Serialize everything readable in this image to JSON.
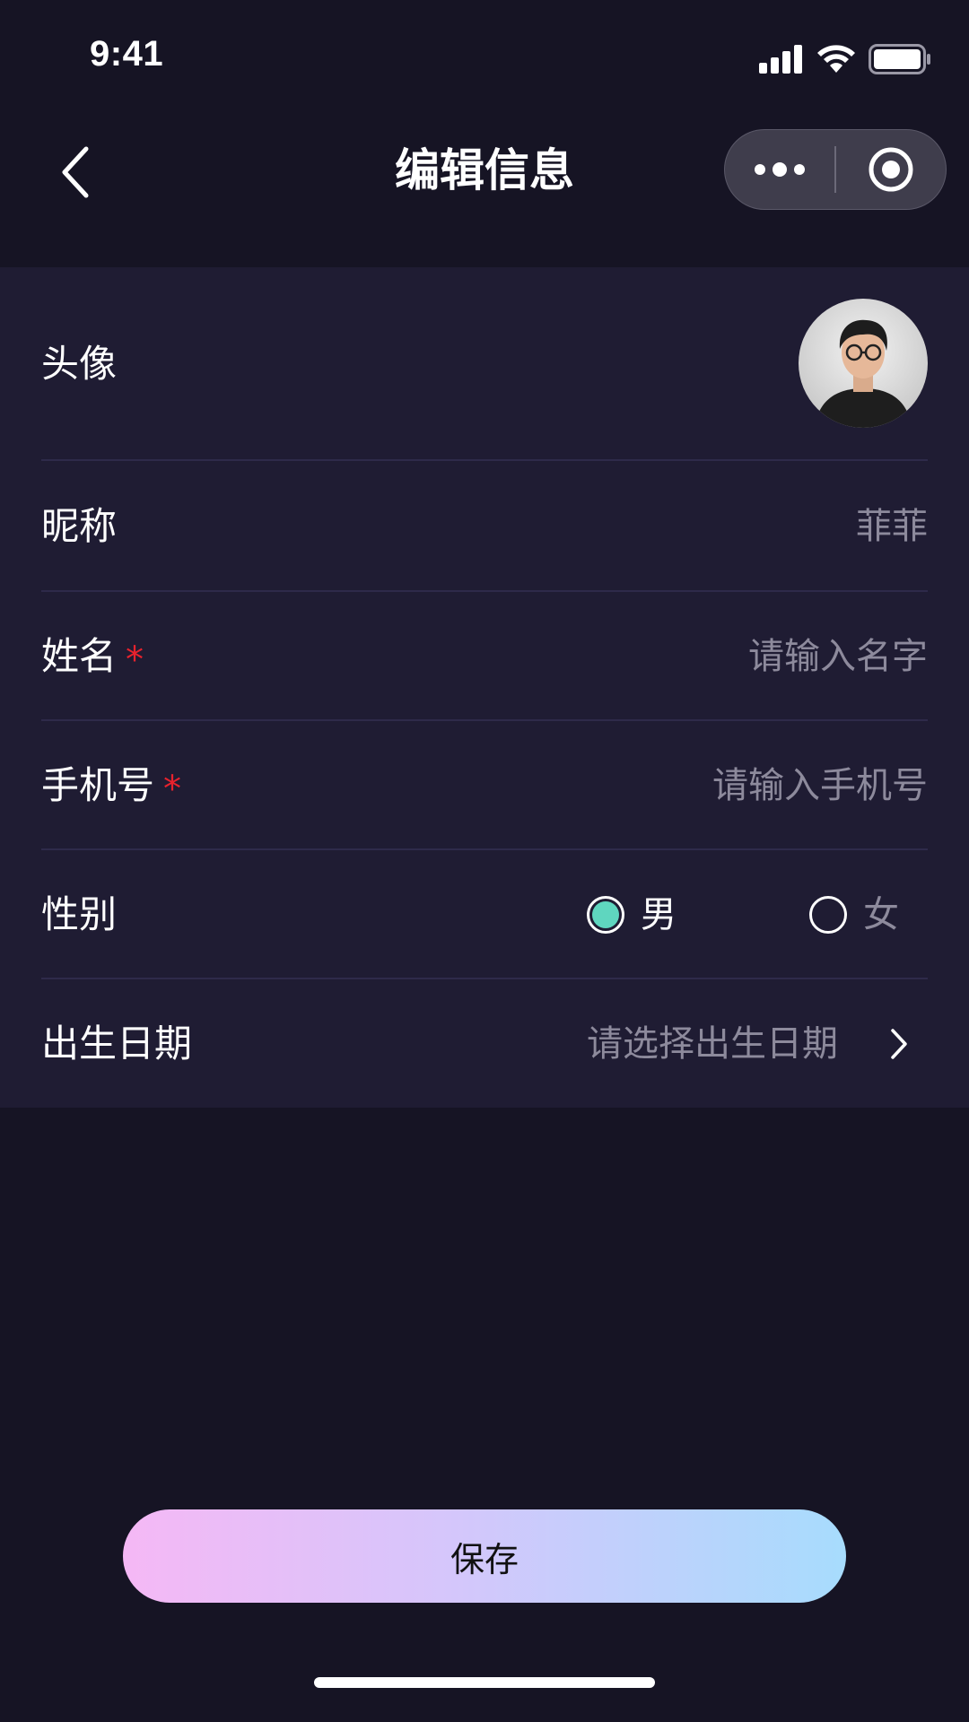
{
  "status_bar": {
    "time": "9:41"
  },
  "nav": {
    "title": "编辑信息"
  },
  "form": {
    "avatar": {
      "label": "头像"
    },
    "nickname": {
      "label": "昵称",
      "value": "菲菲"
    },
    "name": {
      "label": "姓名",
      "required_mark": "*",
      "placeholder": "请输入名字"
    },
    "phone": {
      "label": "手机号",
      "required_mark": "*",
      "placeholder": "请输入手机号"
    },
    "gender": {
      "label": "性别",
      "options": [
        {
          "label": "男",
          "selected": true
        },
        {
          "label": "女",
          "selected": false
        }
      ]
    },
    "birthday": {
      "label": "出生日期",
      "placeholder": "请选择出生日期"
    }
  },
  "save_button": {
    "label": "保存"
  },
  "colors": {
    "background": "#161424",
    "form_background": "#1f1c33",
    "required": "#e8222d",
    "radio_selected": "#5fd6bf",
    "placeholder_text": "#8d8a9c",
    "button_gradient_start": "#f5b8f5",
    "button_gradient_end": "#a7dcfd"
  },
  "icons": {
    "back": "chevron-left-icon",
    "more": "more-dots-icon",
    "close": "target-circle-icon",
    "birthday_arrow": "chevron-right-icon",
    "signal": "cellular-signal-icon",
    "wifi": "wifi-icon",
    "battery": "battery-icon"
  }
}
